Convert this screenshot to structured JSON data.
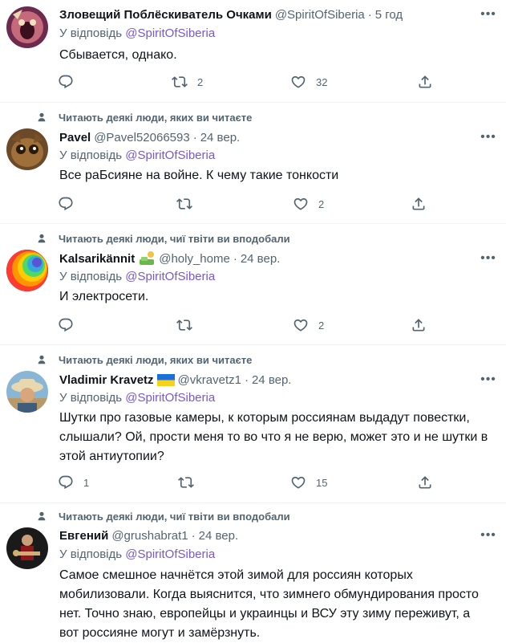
{
  "tweets": [
    {
      "name": "Зловещий Поблёскиватель Очками",
      "handle": "@SpiritOfSiberia",
      "dot": "·",
      "time": "5 год",
      "reply_prefix": "У відповідь",
      "reply_to": "@SpiritOfSiberia",
      "text": "Сбывается, однако.",
      "reply_count": "",
      "retweet_count": "2",
      "like_count": "32"
    },
    {
      "social": "Читають деякі люди, яких ви читаєте",
      "name": "Pavel",
      "handle": "@Pavel52066593",
      "dot": "·",
      "time": "24 вер.",
      "reply_prefix": "У відповідь",
      "reply_to": "@SpiritOfSiberia",
      "text": "Все раБсияне на войне. К чему такие тонкости",
      "reply_count": "",
      "retweet_count": "",
      "like_count": "2"
    },
    {
      "social": "Читають деякі люди, чиї твіти ви вподобали",
      "name": "Kalsarikännit",
      "handle": "@holy_home",
      "dot": "·",
      "time": "24 вер.",
      "reply_prefix": "У відповідь",
      "reply_to": "@SpiritOfSiberia",
      "text": "И электросети.",
      "reply_count": "",
      "retweet_count": "",
      "like_count": "2"
    },
    {
      "social": "Читають деякі люди, яких ви читаєте",
      "name": "Vladimir Kravetz",
      "handle": "@vkravetz1",
      "dot": "·",
      "time": "24 вер.",
      "reply_prefix": "У відповідь",
      "reply_to": "@SpiritOfSiberia",
      "text": "Шутки про газовые камеры, к которым россиянам выдадут повестки, слышали? Ой, прости меня то во что я не верю, может это и не шутки в этой антиутопии?",
      "reply_count": "1",
      "retweet_count": "",
      "like_count": "15"
    },
    {
      "social": "Читають деякі люди, чиї твіти ви вподобали",
      "name": "Евгений",
      "handle": "@grushabrat1",
      "dot": "·",
      "time": "24 вер.",
      "reply_prefix": "У відповідь",
      "reply_to": "@SpiritOfSiberia",
      "text": "Самое смешное начнётся этой зимой для россиян которых мобилизовали. Когда выяснится, что зимнего обмундирования просто нет. Точно знаю, европейцы и украинцы и ВСУ эту зиму переживут, а вот россияне могут и замёрзнуть."
    }
  ],
  "icons": {
    "more": "more-horizontal-icon",
    "reply": "reply-bubble-icon",
    "retweet": "retweet-icon",
    "like": "heart-icon",
    "share": "share-upload-icon",
    "person": "person-icon",
    "tree_badge": "tree-badge-icon",
    "ukraine_flag": "ukraine-flag-icon"
  },
  "colors": {
    "text": "#0f1419",
    "secondary": "#536471",
    "mention": "#7856d6",
    "divider": "#eff3f4"
  }
}
